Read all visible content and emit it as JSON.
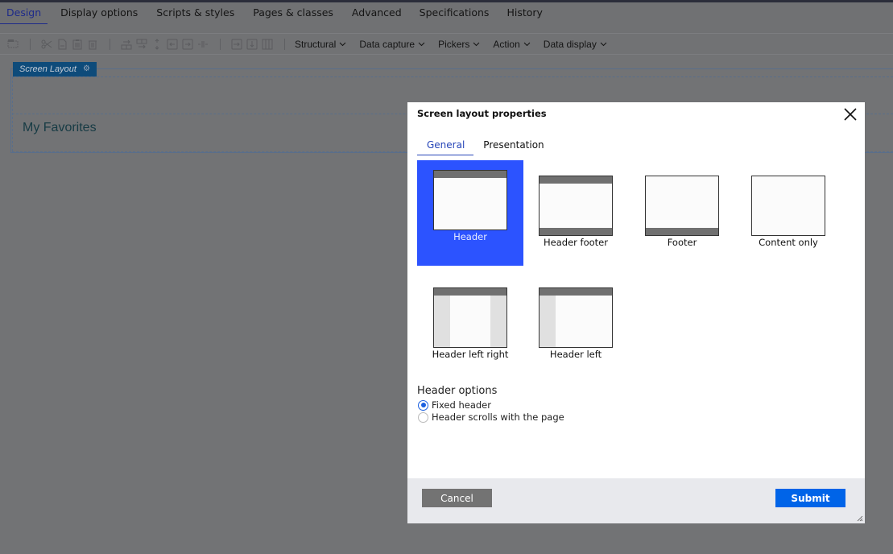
{
  "tabs": [
    {
      "label": "Design",
      "active": true
    },
    {
      "label": "Display options"
    },
    {
      "label": "Scripts & styles"
    },
    {
      "label": "Pages & classes"
    },
    {
      "label": "Advanced"
    },
    {
      "label": "Specifications"
    },
    {
      "label": "History"
    }
  ],
  "toolbar": {
    "icons": [
      "layout-icon",
      "cut-icon",
      "copy-icon",
      "paste-icon",
      "delete-icon",
      "insert-row-above-icon",
      "insert-row-below-icon",
      "move-row-icon",
      "insert-col-left-icon",
      "insert-col-right-icon",
      "split-icon",
      "merge-right-icon",
      "merge-down-icon",
      "columns-icon"
    ],
    "menus": [
      "Structural",
      "Data capture",
      "Pickers",
      "Action",
      "Data display"
    ]
  },
  "canvas": {
    "layout_label": "Screen Layout",
    "section_title": "My Favorites"
  },
  "modal": {
    "title": "Screen layout properties",
    "tabs": [
      {
        "label": "General",
        "active": true
      },
      {
        "label": "Presentation"
      }
    ],
    "layouts": [
      {
        "label": "Header",
        "selected": true
      },
      {
        "label": "Header footer"
      },
      {
        "label": "Footer"
      },
      {
        "label": "Content only"
      },
      {
        "label": "Header left right"
      },
      {
        "label": "Header left"
      }
    ],
    "header_options": {
      "title": "Header options",
      "options": [
        {
          "label": "Fixed header",
          "checked": true
        },
        {
          "label": "Header scrolls with the page",
          "checked": false
        }
      ]
    },
    "cancel_label": "Cancel",
    "submit_label": "Submit"
  },
  "colors": {
    "selected_layout": "#2c53ff",
    "submit": "#0064e8",
    "cancel": "#737373"
  }
}
